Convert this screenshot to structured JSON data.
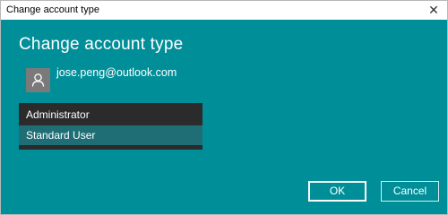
{
  "window": {
    "title": "Change account type",
    "close_glyph": "✕"
  },
  "dialog": {
    "heading": "Change account type",
    "account_email": "jose.peng@outlook.com",
    "avatar_icon": "user-icon"
  },
  "account_type": {
    "options": [
      {
        "label": "Administrator",
        "selected": false
      },
      {
        "label": "Standard User",
        "selected": true
      }
    ]
  },
  "buttons": {
    "ok_label": "OK",
    "cancel_label": "Cancel"
  },
  "colors": {
    "background": "#008f99",
    "dropdown": "#2b2b2b",
    "selected_option": "#1f6e75",
    "text": "#ffffff"
  }
}
